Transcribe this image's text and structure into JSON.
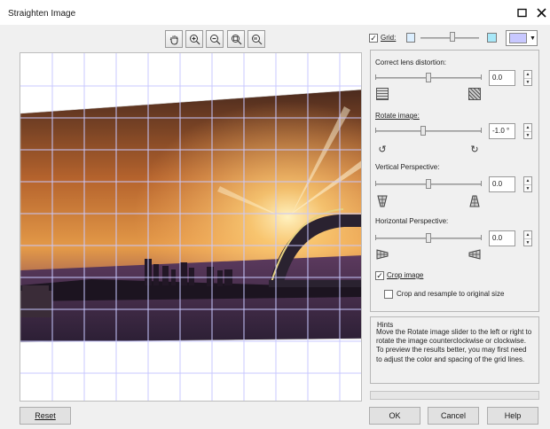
{
  "window": {
    "title": "Straighten Image"
  },
  "toolbar": {
    "tools": [
      "hand-icon",
      "zoom-in-icon",
      "zoom-out-icon",
      "zoom-to-fit-icon",
      "zoom-actual-size-icon"
    ]
  },
  "grid": {
    "label": "Grid:",
    "checked": true,
    "level": 0.55,
    "color": "#c8c8ff"
  },
  "controls": {
    "lens": {
      "label": "Correct lens distortion:",
      "value": "0.0",
      "level": 0.5
    },
    "rotate": {
      "label": "Rotate image:",
      "value": "-1.0 °",
      "level": 0.45
    },
    "vertical": {
      "label": "Vertical Perspective:",
      "value": "0.0",
      "level": 0.5
    },
    "horizontal": {
      "label": "Horizontal Perspective:",
      "value": "0.0",
      "level": 0.5
    }
  },
  "crop": {
    "label": "Crop image",
    "checked": true
  },
  "resample": {
    "label": "Crop and resample to original size",
    "checked": false
  },
  "hints": {
    "title": "Hints",
    "text": "Move the Rotate image slider to the left or right to rotate the image counterclockwise or clockwise. To preview the results better, you may first need to adjust the color and spacing of the grid lines."
  },
  "buttons": {
    "reset": "Reset",
    "ok": "OK",
    "cancel": "Cancel",
    "help": "Help"
  }
}
